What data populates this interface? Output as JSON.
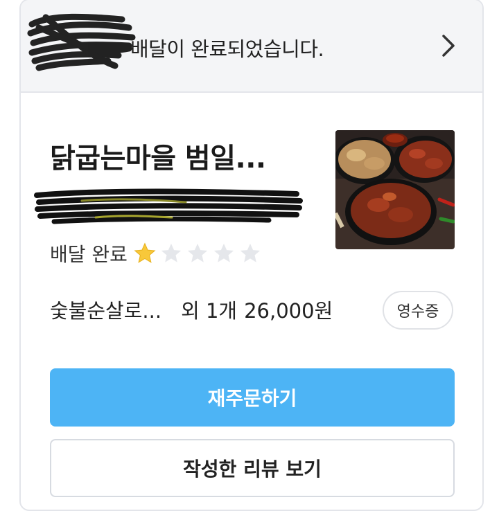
{
  "notice": {
    "text": "배달이 완료되었습니다."
  },
  "order": {
    "store_name": "닭굽는마을 범일...",
    "status": "배달 완료",
    "rating": 1,
    "rating_max": 5,
    "menu": "숯불순살로...",
    "extra_count": "외 1개",
    "price": "26,000원",
    "receipt_label": "영수증"
  },
  "actions": {
    "reorder_label": "재주문하기",
    "view_review_label": "작성한 리뷰 보기"
  },
  "colors": {
    "primary": "#4db4f5",
    "star_filled": "#f8c83a",
    "star_empty": "#e5e7eb"
  },
  "icons": {
    "chevron": "chevron-right-icon",
    "star": "star-icon"
  }
}
